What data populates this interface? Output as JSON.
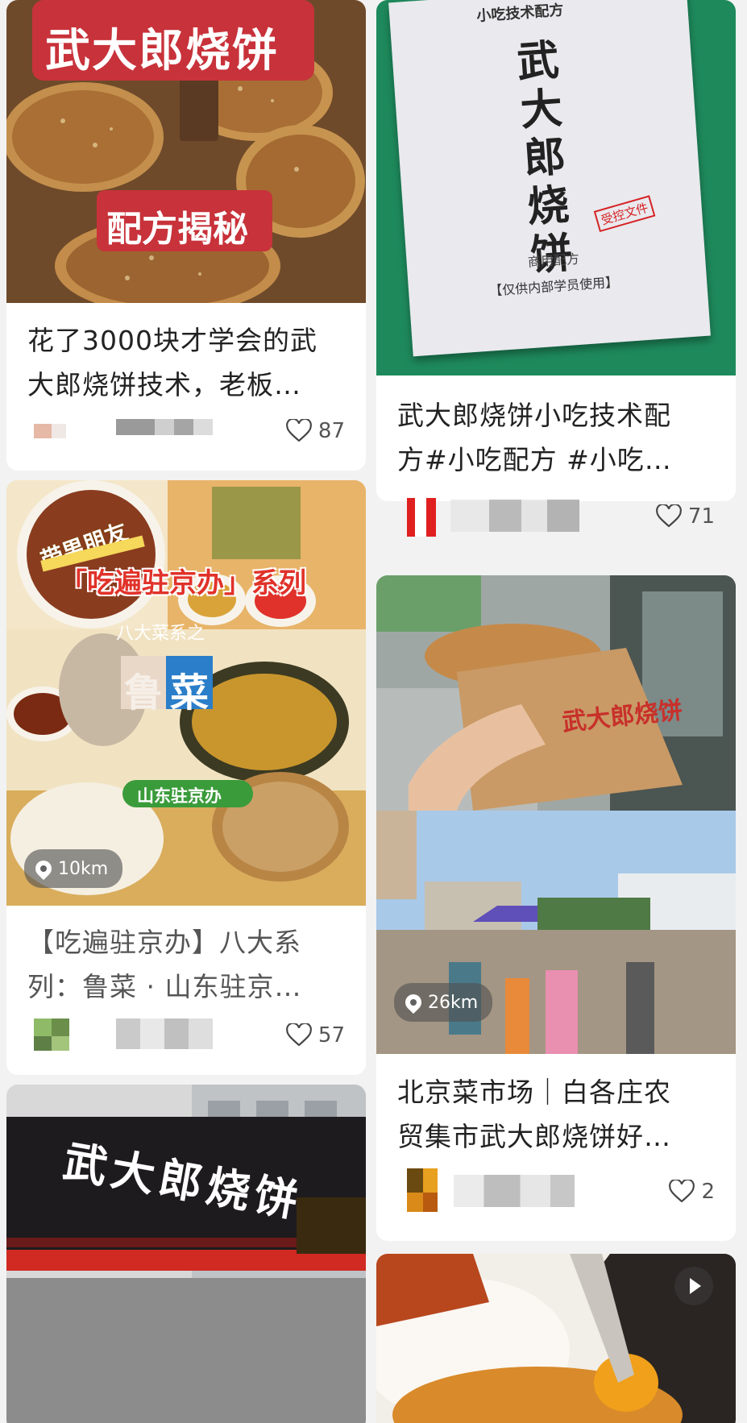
{
  "feed": {
    "left": [
      {
        "title_lines": [
          "花了3000块才学会的武",
          "大郎烧饼技术，老板…"
        ],
        "overlay_title": "武大郎烧饼",
        "overlay_badge": "配方揭秘",
        "likes": "87"
      },
      {
        "title_lines": [
          "【吃遍驻京办】八大系",
          "列：鲁菜 · 山东驻京…"
        ],
        "overlay_tag1": "带男朋友",
        "overlay_series": "「吃遍驻京办」系列",
        "overlay_sub": "八大菜系之",
        "overlay_cuisine_1": "鲁",
        "overlay_cuisine_2": "菜",
        "overlay_place": "山东驻京办",
        "distance": "10km",
        "likes": "57"
      },
      {
        "overlay_sign": "武大郎烧饼"
      }
    ],
    "right": [
      {
        "title_lines": [
          "武大郎烧饼小吃技术配",
          "方#小吃配方 #小吃…"
        ],
        "doc_header": "小吃技术配方",
        "doc_title": "武大郎烧饼",
        "doc_stamp": "受控文件",
        "doc_sub": "商用配方",
        "doc_note": "【仅供内部学员使用】",
        "likes": "71"
      },
      {
        "title_lines": [
          "北京菜市场｜白各庄农",
          "贸集市武大郎烧饼好…"
        ],
        "bag_text": "武大郎烧饼",
        "distance": "26km",
        "likes": "2"
      },
      {}
    ]
  },
  "icons": {
    "like": "heart-outline-icon",
    "location": "location-pin-icon",
    "play": "play-icon"
  }
}
